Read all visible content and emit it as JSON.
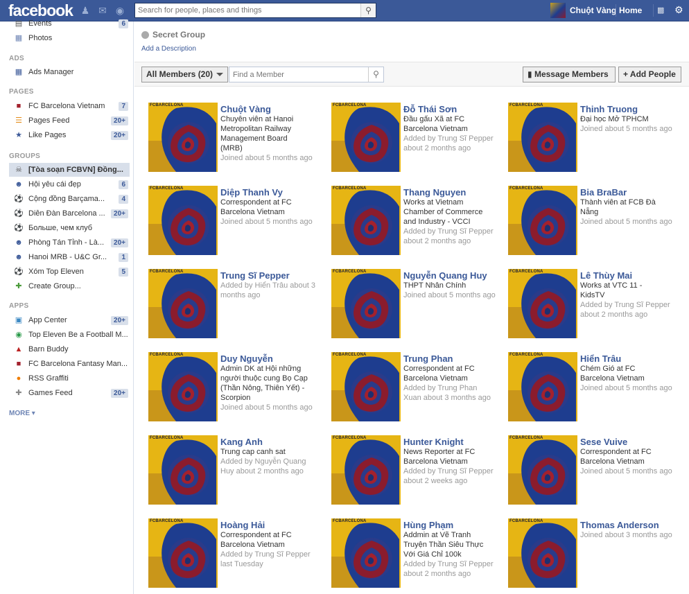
{
  "topbar": {
    "logo": "facebook",
    "search_placeholder": "Search for people, places and things",
    "user_name": "Chuột Vàng",
    "home": "Home"
  },
  "sidebar": {
    "top_items": [
      {
        "label": "Events",
        "count": "6",
        "icon": "calendar-icon"
      },
      {
        "label": "Photos",
        "count": "",
        "icon": "photos-icon"
      }
    ],
    "ads_head": "ADS",
    "ads_items": [
      {
        "label": "Ads Manager",
        "count": "",
        "icon": "chart-icon"
      }
    ],
    "pages_head": "PAGES",
    "pages_items": [
      {
        "label": "FC Barcelona Vietnam",
        "count": "7",
        "icon": "page-icon"
      },
      {
        "label": "Pages Feed",
        "count": "20+",
        "icon": "feed-icon"
      },
      {
        "label": "Like Pages",
        "count": "20+",
        "icon": "like-icon"
      }
    ],
    "groups_head": "GROUPS",
    "groups_items": [
      {
        "label": "[Tòa soạn FCBVN] Đồng...",
        "count": "",
        "icon": "skull-icon"
      },
      {
        "label": "Hội yêu cái đẹp",
        "count": "6",
        "icon": "group-icon"
      },
      {
        "label": "Cộng đồng Barçama...",
        "count": "4",
        "icon": "ball-icon"
      },
      {
        "label": "Diễn Đàn Barcelona ...",
        "count": "20+",
        "icon": "ball-icon"
      },
      {
        "label": "Больше, чем клуб",
        "count": "",
        "icon": "ball-icon"
      },
      {
        "label": "Phòng Tán Tỉnh - Là...",
        "count": "20+",
        "icon": "group-icon"
      },
      {
        "label": "Hanoi MRB - U&C Gr...",
        "count": "1",
        "icon": "group-icon"
      },
      {
        "label": "Xóm Top Eleven",
        "count": "5",
        "icon": "ball-icon"
      },
      {
        "label": "Create Group...",
        "count": "",
        "icon": "create-group-icon"
      }
    ],
    "apps_head": "APPS",
    "apps_items": [
      {
        "label": "App Center",
        "count": "20+",
        "icon": "app-center-icon"
      },
      {
        "label": "Top Eleven Be a Football M...",
        "count": "",
        "icon": "top-eleven-icon"
      },
      {
        "label": "Barn Buddy",
        "count": "",
        "icon": "barn-icon"
      },
      {
        "label": "FC Barcelona Fantasy Man...",
        "count": "",
        "icon": "fcb-fantasy-icon"
      },
      {
        "label": "RSS Graffiti",
        "count": "",
        "icon": "rss-icon"
      },
      {
        "label": "Games Feed",
        "count": "20+",
        "icon": "games-icon"
      }
    ],
    "more": "MORE"
  },
  "group": {
    "title": "Secret Group",
    "add_description": "Add a Description"
  },
  "toolbar": {
    "filter": "All Members (20)",
    "find_placeholder": "Find a Member",
    "message": "Message Members",
    "add_people": "Add People"
  },
  "members": [
    {
      "name": "Chuột Vàng",
      "lines": [
        "Chuyên viên at Hanoi",
        "Metropolitan Railway",
        "Management Board",
        "(MRB)"
      ],
      "grey": [
        "Joined about 5 months ago"
      ]
    },
    {
      "name": "Đỗ Thái Sơn",
      "lines": [
        "Đầu gấu Xã at FC",
        "Barcelona Vietnam"
      ],
      "grey": [
        "Added by Trung Sĩ Pepper",
        "about 2 months ago"
      ]
    },
    {
      "name": "Thinh Truong",
      "lines": [
        "Đại học Mở TPHCM"
      ],
      "grey": [
        "Joined about 5 months ago"
      ]
    },
    {
      "name": "Diệp Thanh Vy",
      "lines": [
        "Correspondent at FC",
        "Barcelona Vietnam"
      ],
      "grey": [
        "Joined about 5 months ago"
      ]
    },
    {
      "name": "Thang Nguyen",
      "lines": [
        "Works at Vietnam",
        "Chamber of Commerce",
        "and Industry - VCCI"
      ],
      "grey": [
        "Added by Trung Sĩ Pepper",
        "about 2 months ago"
      ]
    },
    {
      "name": "Bia BraBar",
      "lines": [
        "Thành viên at FCB Đà",
        "Nẵng"
      ],
      "grey": [
        "Joined about 5 months ago"
      ]
    },
    {
      "name": "Trung Sĩ Pepper",
      "lines": [],
      "grey": [
        "Added by Hiển Trâu about 3",
        "months ago"
      ]
    },
    {
      "name": "Nguyễn Quang Huy",
      "lines": [
        "THPT Nhân Chính"
      ],
      "grey": [
        "Joined about 5 months ago"
      ]
    },
    {
      "name": "Lê Thùy Mai",
      "lines": [
        "Works at VTC 11 -",
        "KidsTV"
      ],
      "grey": [
        "Added by Trung Sĩ Pepper",
        "about 2 months ago"
      ]
    },
    {
      "name": "Duy Nguyễn",
      "lines": [
        "Admin DK at Hội những",
        "người thuộc cung Bọ Cạp",
        "(Thần Nông, Thiên Yết) -",
        "Scorpion"
      ],
      "grey": [
        "Joined about 5 months ago"
      ]
    },
    {
      "name": "Trung Phan",
      "lines": [
        "Correspondent at FC",
        "Barcelona Vietnam"
      ],
      "grey": [
        "Added by Trung Phan",
        "Xuan about 3 months ago"
      ]
    },
    {
      "name": "Hiển Trâu",
      "lines": [
        "Chém Gió at FC",
        "Barcelona Vietnam"
      ],
      "grey": [
        "Joined about 5 months ago"
      ]
    },
    {
      "name": "Kang Anh",
      "lines": [
        "Trung cap canh sat"
      ],
      "grey": [
        "Added by Nguyễn Quang",
        "Huy about 2 months ago"
      ]
    },
    {
      "name": "Hunter Knight",
      "lines": [
        "News Reporter at FC",
        "Barcelona Vietnam"
      ],
      "grey": [
        "Added by Trung Sĩ Pepper",
        "about 2 weeks ago"
      ]
    },
    {
      "name": "Sese Vuive",
      "lines": [
        "Correspondent at FC",
        "Barcelona Vietnam"
      ],
      "grey": [
        "Joined about 5 months ago"
      ]
    },
    {
      "name": "Hoàng Hải",
      "lines": [
        "Correspondent at FC",
        "Barcelona Vietnam"
      ],
      "grey": [
        "Added by Trung Sĩ Pepper",
        "last Tuesday"
      ]
    },
    {
      "name": "Hùng Phạm",
      "lines": [
        "Addmin at Vẽ Tranh",
        "Truyện Thần Siêu Thực",
        "Với Giá Chỉ 100k"
      ],
      "grey": [
        "Added by Trung Sĩ Pepper",
        "about 2 months ago"
      ]
    },
    {
      "name": "Thomas Anderson",
      "lines": [],
      "grey": [
        "Joined about 3 months ago"
      ]
    }
  ],
  "photo_caption": "FCBARCELONA",
  "colors": {
    "brand": "#3b5998",
    "link": "#3b5998",
    "photo_bg": "#e6b514"
  }
}
